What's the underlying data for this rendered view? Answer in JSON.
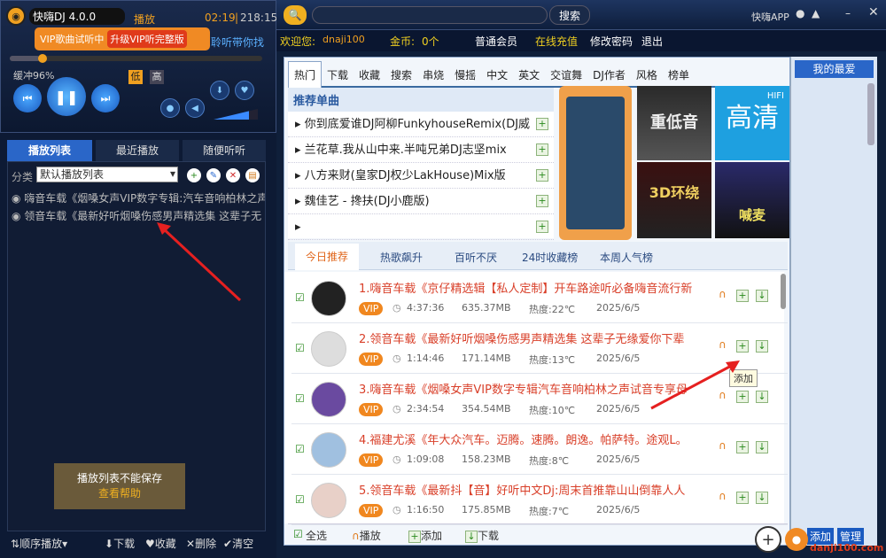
{
  "app": {
    "name": "快嗨DJ 4.0.0",
    "play_label": "播放",
    "time_current": "02:19",
    "time_total": "218:15",
    "buffer": "缓冲96%",
    "low": "低",
    "high": "高"
  },
  "vip_banner": {
    "trial": "VIP歌曲试听中",
    "upgrade": "升级VIP听完整版",
    "marquee": "聆听带你找"
  },
  "search": {
    "placeholder": "",
    "button": "搜索",
    "app_label": "快嗨APP"
  },
  "user": {
    "welcome": "欢迎您:",
    "name": "dnaji100",
    "coins_label": "金币:",
    "coins": "0个",
    "level": "普通会员",
    "recharge": "在线充值",
    "change_pwd": "修改密码",
    "logout": "退出"
  },
  "left_tabs": [
    "播放列表",
    "最近播放",
    "随便听听"
  ],
  "category": {
    "label": "分类",
    "value": "默认播放列表"
  },
  "playlist": [
    "嗨音车载《烟嗓女声VIP数字专辑:汽车音响柏林之声",
    "领音车载《最新好听烟嗓伤感男声精选集 这辈子无"
  ],
  "tooltip_save": {
    "line1": "播放列表不能保存",
    "line2": "查看帮助"
  },
  "left_bottom": {
    "order": "顺序播放",
    "download": "下载",
    "fav": "收藏",
    "delete": "删除",
    "clear": "清空"
  },
  "nav_tabs": [
    "热门",
    "下载",
    "收藏",
    "搜索",
    "串烧",
    "慢摇",
    "中文",
    "英文",
    "交谊舞",
    "DJ作者",
    "风格",
    "榜单"
  ],
  "recommend": {
    "title": "推荐单曲",
    "items": [
      "你到底爱谁DJ阿柳FunkyhouseRemix(DJ威",
      "兰花草.我从山中来.半吨兄弟DJ志坚mix",
      "八方来财(皇家DJ权少LakHouse)Mix版",
      "魏佳艺 - 搀扶(DJ小鹿版)",
      ""
    ]
  },
  "thumbs": {
    "t2": "重低音",
    "t3": "高清",
    "t3b": "HIFI",
    "t5": "3D环绕",
    "t6": "喊麦"
  },
  "sub_tabs": [
    "今日推荐",
    "热歌飙升",
    "百听不厌",
    "24时收藏榜",
    "本周人气榜"
  ],
  "songs": [
    {
      "title": "1.嗨音车载《京仔精选辑【私人定制】开车路途听必备嗨音流行新",
      "dur": "4:37:36",
      "size": "635.37MB",
      "heat": "热度:22℃",
      "date": "2025/6/5"
    },
    {
      "title": "2.领音车载《最新好听烟嗓伤感男声精选集 这辈子无缘爱你下辈",
      "dur": "1:14:46",
      "size": "171.14MB",
      "heat": "热度:13℃",
      "date": "2025/6/5"
    },
    {
      "title": "3.嗨音车载《烟嗓女声VIP数字专辑汽车音响柏林之声试音专享母",
      "dur": "2:34:54",
      "size": "354.54MB",
      "heat": "热度:10℃",
      "date": "2025/6/5"
    },
    {
      "title": "4.福建尤溪《年大众汽车。迈腾。速腾。朗逸。帕萨特。途观L。",
      "dur": "1:09:08",
      "size": "158.23MB",
      "heat": "热度:8℃",
      "date": "2025/6/5"
    },
    {
      "title": "5.领音车载《最新抖【音】好听中文Dj:周末首推靠山山倒靠人人",
      "dur": "1:16:50",
      "size": "175.85MB",
      "heat": "热度:7℃",
      "date": "2025/6/5"
    }
  ],
  "vip_badge": "VIP",
  "add_tooltip": "添加",
  "bottom_bar": {
    "select_all": "全选",
    "play": "播放",
    "add": "添加",
    "download": "下载"
  },
  "right_panel": {
    "title": "我的最爱",
    "add": "添加",
    "manage": "管理"
  },
  "watermark": "danji100.com"
}
